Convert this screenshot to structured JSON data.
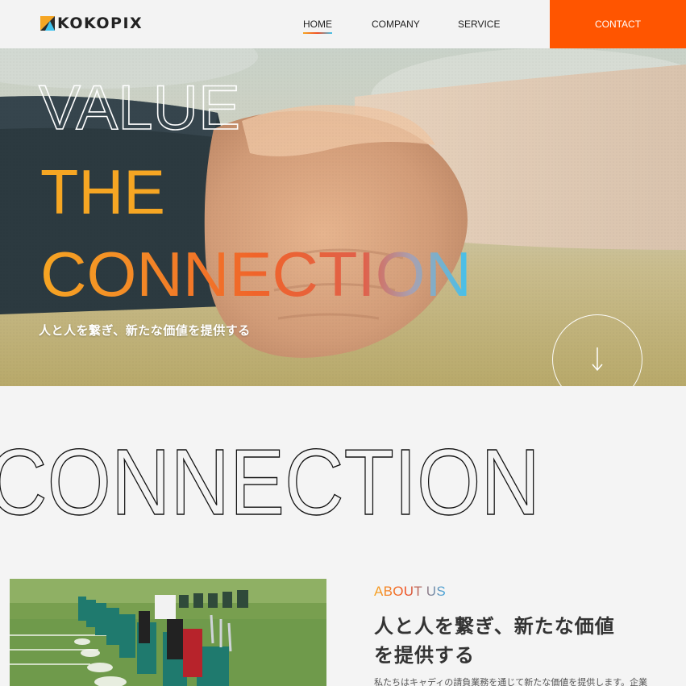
{
  "header": {
    "logo_text": "KOKOPIX",
    "nav": [
      {
        "label": "HOME",
        "active": true
      },
      {
        "label": "COMPANY"
      },
      {
        "label": "SERVICE"
      }
    ],
    "contact_label": "CONTACT"
  },
  "hero": {
    "line1": "VALUE",
    "line2": "THE",
    "line3": "CONNECTION",
    "subtitle": "人と人を繋ぎ、新たな価値を提供する",
    "scroll_arrow": "↓"
  },
  "section_word": "CONNECTION",
  "about": {
    "label": "ABOUT US",
    "heading_line1": "人と人を繋ぎ、新たな価値",
    "heading_line2": "を提供する",
    "text": "私たちはキャディの請負業務を通じて新たな価値を提供します。企業"
  },
  "colors": {
    "accent": "#ff5500",
    "gradient": [
      "#f6a623",
      "#f04e23",
      "#3fc3ee"
    ]
  }
}
